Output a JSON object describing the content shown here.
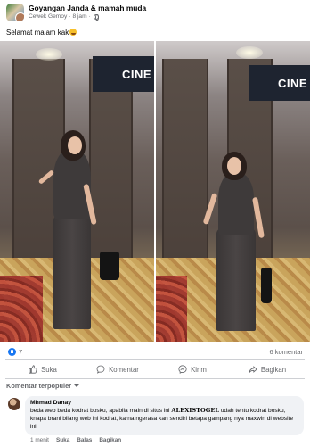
{
  "post": {
    "group_name": "Goyangan Janda & mamah muda",
    "author": "Cewek Gemoy",
    "time": "8 jam",
    "caption": "Selamat malam kak"
  },
  "photos": {
    "sign_text": "CINE"
  },
  "stats": {
    "reaction_count": "7",
    "comment_count": "6 komentar"
  },
  "actions": {
    "like_label": "Suka",
    "comment_label": "Komentar",
    "send_label": "Kirim",
    "share_label": "Bagikan"
  },
  "comments": {
    "sort_label": "Komentar terpopuler",
    "items": [
      {
        "author": "Mhmad Danay",
        "text_before": "beda web beda kodrat bosku, apabila main di situs ini ",
        "brand": "ALEXISTOGEL",
        "text_after": " udah tentu kodrat bosku, knapa brani bilang web ini kodrat, karna ngerasa kan sendiri betapa gampang nya maxwin di website ini",
        "time": "1 menit",
        "like_label": "Suka",
        "reply_label": "Balas",
        "share_label": "Bagikan"
      }
    ]
  },
  "colors": {
    "accent": "#1877f2",
    "secondary_text": "#65676b",
    "bubble_bg": "#f0f2f5"
  }
}
